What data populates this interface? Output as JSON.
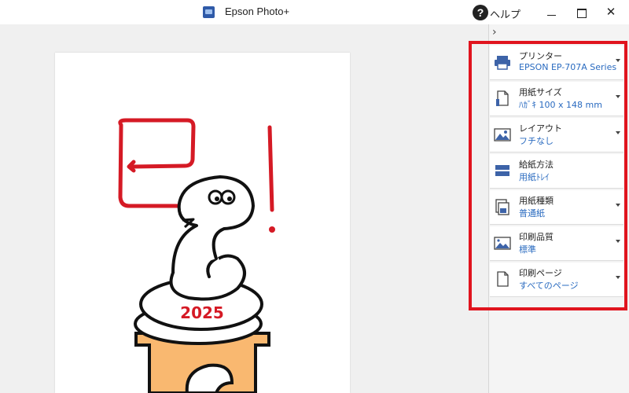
{
  "window": {
    "title": "Epson Photo+",
    "help_label": "ヘルプ",
    "help_glyph": "?",
    "close_glyph": "✕"
  },
  "panel": {
    "collapse_glyph": "›",
    "accent_color": "#2a6bc0",
    "highlight_color": "#e0141e",
    "settings": [
      {
        "label": "プリンター",
        "value": "EPSON EP-707A Series",
        "icon": "printer-icon",
        "has_dropdown": true
      },
      {
        "label": "用紙サイズ",
        "value": "ﾊｶﾞｷ 100 x 148 mm",
        "icon": "paper-size-icon",
        "has_dropdown": true
      },
      {
        "label": "レイアウト",
        "value": "フチなし",
        "icon": "layout-icon",
        "has_dropdown": true
      },
      {
        "label": "給紙方法",
        "value": "用紙ﾄﾚｲ",
        "icon": "paper-feed-icon",
        "has_dropdown": false
      },
      {
        "label": "用紙種類",
        "value": "普通紙",
        "icon": "paper-type-icon",
        "has_dropdown": true
      },
      {
        "label": "印刷品質",
        "value": "標準",
        "icon": "print-quality-icon",
        "has_dropdown": true
      },
      {
        "label": "印刷ページ",
        "value": "すべてのページ",
        "icon": "print-pages-icon",
        "has_dropdown": true
      }
    ]
  },
  "preview": {
    "illustration": "snake-kagami-mochi-illustration",
    "year_text": "2025"
  }
}
